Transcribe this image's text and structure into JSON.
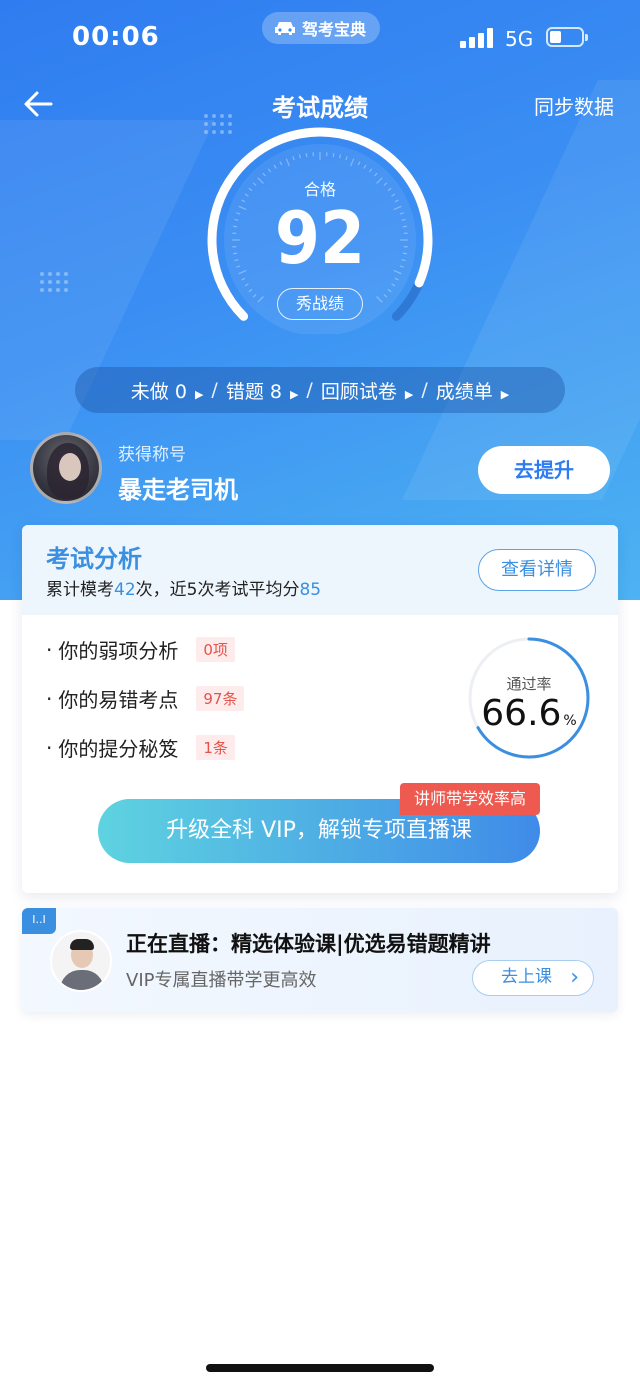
{
  "status_bar": {
    "time": "00:06",
    "app_name": "驾考宝典",
    "network": "5G",
    "battery_level": 0.35
  },
  "nav": {
    "title": "考试成绩",
    "sync_label": "同步数据",
    "back_icon": "arrow-left-icon"
  },
  "score": {
    "label": "合格",
    "value": "92",
    "share_label": "秀战绩",
    "max": 100
  },
  "stats": {
    "items": [
      {
        "label": "未做 0"
      },
      {
        "label": "错题  8"
      },
      {
        "label": "回顾试卷"
      },
      {
        "label": "成绩单"
      }
    ]
  },
  "user": {
    "title_label": "获得称号",
    "title_value": "暴走老司机",
    "improve_label": "去提升"
  },
  "analysis": {
    "title": "考试分析",
    "summary": {
      "prefix": "累计模考",
      "count": "42",
      "middle": "次，近5次考试平均分",
      "avg": "85"
    },
    "detail_label": "查看详情",
    "items": [
      {
        "label": "你的弱项分析",
        "tag": "0项"
      },
      {
        "label": "你的易错考点",
        "tag": "97条"
      },
      {
        "label": "你的提分秘笈",
        "tag": "1条"
      }
    ],
    "pass_rate": {
      "label": "通过率",
      "value": "66.6",
      "unit": "%",
      "fraction": 0.666
    },
    "vip_button": "升级全科 VIP，解锁专项直播课",
    "vip_badge": "讲师带学效率高"
  },
  "live": {
    "tag": "I..I",
    "title": "正在直播：精选体验课|优选易错题精讲",
    "subtitle": "VIP专属直播带学更高效",
    "button": "去上课"
  },
  "colors": {
    "accent": "#3a8fe0",
    "hero_start": "#2f7cf0",
    "hero_end": "#4db3f2",
    "tag_red": "#e5534b"
  }
}
